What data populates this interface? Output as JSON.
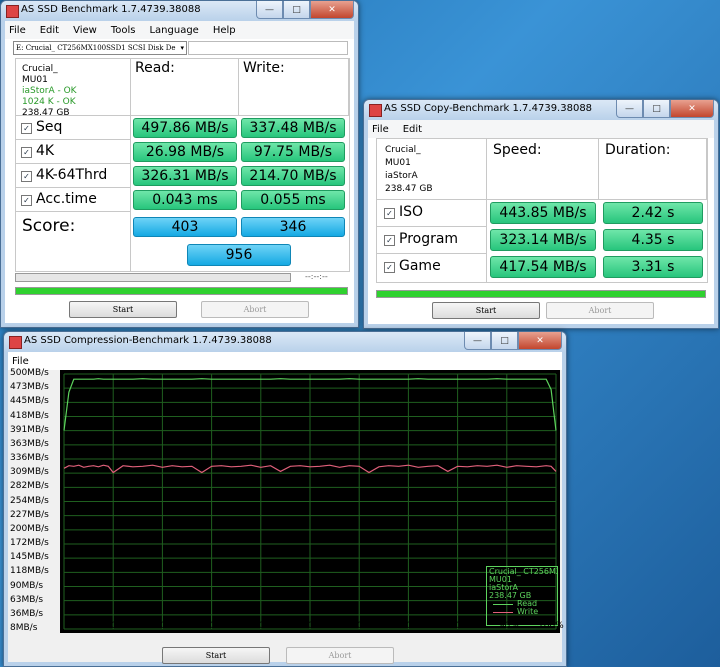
{
  "main_window": {
    "title": "AS SSD Benchmark 1.7.4739.38088",
    "menu": [
      "File",
      "Edit",
      "View",
      "Tools",
      "Language",
      "Help"
    ],
    "drive_select": "E: Crucial_ CT256MX100SSD1 SCSI Disk De",
    "info": [
      "Crucial_",
      "MU01",
      "iaStorA - OK",
      "1024 K - OK",
      "238.47 GB"
    ],
    "read_header": "Read:",
    "write_header": "Write:",
    "rows": [
      {
        "label": "Seq",
        "read": "497.86 MB/s",
        "write": "337.48 MB/s"
      },
      {
        "label": "4K",
        "read": "26.98 MB/s",
        "write": "97.75 MB/s"
      },
      {
        "label": "4K-64Thrd",
        "read": "326.31 MB/s",
        "write": "214.70 MB/s"
      },
      {
        "label": "Acc.time",
        "read": "0.043 ms",
        "write": "0.055 ms"
      }
    ],
    "score_label": "Score:",
    "score_read": "403",
    "score_write": "346",
    "score_total": "956",
    "timer": "--:--:--",
    "progress": 1.0,
    "start_label": "Start",
    "abort_label": "Abort"
  },
  "copy_window": {
    "title": "AS SSD Copy-Benchmark 1.7.4739.38088",
    "menu": [
      "File",
      "Edit"
    ],
    "info": [
      "Crucial_",
      "MU01",
      "iaStorA",
      "238.47 GB"
    ],
    "speed_header": "Speed:",
    "duration_header": "Duration:",
    "rows": [
      {
        "label": "ISO",
        "speed": "443.85 MB/s",
        "duration": "2.42 s"
      },
      {
        "label": "Program",
        "speed": "323.14 MB/s",
        "duration": "4.35 s"
      },
      {
        "label": "Game",
        "speed": "417.54 MB/s",
        "duration": "3.31 s"
      }
    ],
    "progress": 1.0,
    "start_label": "Start",
    "abort_label": "Abort"
  },
  "compression_window": {
    "title": "AS SSD Compression-Benchmark 1.7.4739.38088",
    "menu": [
      "File"
    ],
    "legend_info": [
      "Crucial_ CT256MX1",
      "MU01",
      "iaStorA",
      "238.47 GB"
    ],
    "legend_read": "Read",
    "legend_write": "Write",
    "start_label": "Start",
    "abort_label": "Abort"
  },
  "chart_data": {
    "type": "line",
    "ylabels": [
      "500MB/s",
      "473MB/s",
      "445MB/s",
      "418MB/s",
      "391MB/s",
      "363MB/s",
      "336MB/s",
      "309MB/s",
      "282MB/s",
      "254MB/s",
      "227MB/s",
      "200MB/s",
      "172MB/s",
      "145MB/s",
      "118MB/s",
      "90MB/s",
      "63MB/s",
      "36MB/s",
      "8MB/s"
    ],
    "xlabels": [
      "0%",
      "10%",
      "20%",
      "30%",
      "40%",
      "50%",
      "60%",
      "70%",
      "80%",
      "90%",
      "100%"
    ],
    "ylim": [
      8,
      500
    ],
    "x": [
      0,
      1,
      2,
      3,
      4,
      5,
      6,
      7,
      8,
      9,
      10,
      12,
      14,
      16,
      18,
      20,
      22,
      24,
      26,
      28,
      30,
      32,
      34,
      36,
      38,
      40,
      42,
      44,
      46,
      48,
      50,
      52,
      54,
      56,
      58,
      60,
      62,
      64,
      66,
      68,
      70,
      72,
      74,
      76,
      78,
      80,
      82,
      84,
      86,
      88,
      90,
      92,
      94,
      96,
      98,
      99,
      100
    ],
    "series": [
      {
        "name": "Read",
        "color": "#5dd35d",
        "values": [
          391,
          465,
          490,
          490,
          490,
          490,
          490,
          491,
          490,
          490,
          490,
          490,
          490,
          491,
          490,
          490,
          490,
          490,
          490,
          491,
          490,
          490,
          490,
          490,
          490,
          490,
          490,
          491,
          490,
          490,
          490,
          490,
          490,
          490,
          491,
          490,
          490,
          490,
          490,
          490,
          490,
          491,
          490,
          490,
          490,
          490,
          490,
          490,
          490,
          491,
          490,
          490,
          490,
          490,
          490,
          470,
          391
        ]
      },
      {
        "name": "Write",
        "color": "#e0607a",
        "values": [
          318,
          323,
          322,
          324,
          320,
          322,
          323,
          321,
          324,
          322,
          310,
          323,
          321,
          322,
          324,
          320,
          323,
          321,
          322,
          310,
          322,
          323,
          321,
          322,
          324,
          320,
          323,
          312,
          322,
          323,
          321,
          322,
          324,
          320,
          323,
          322,
          310,
          321,
          323,
          322,
          324,
          320,
          322,
          323,
          312,
          322,
          321,
          323,
          322,
          324,
          320,
          323,
          322,
          321,
          323,
          322,
          312
        ]
      }
    ]
  }
}
